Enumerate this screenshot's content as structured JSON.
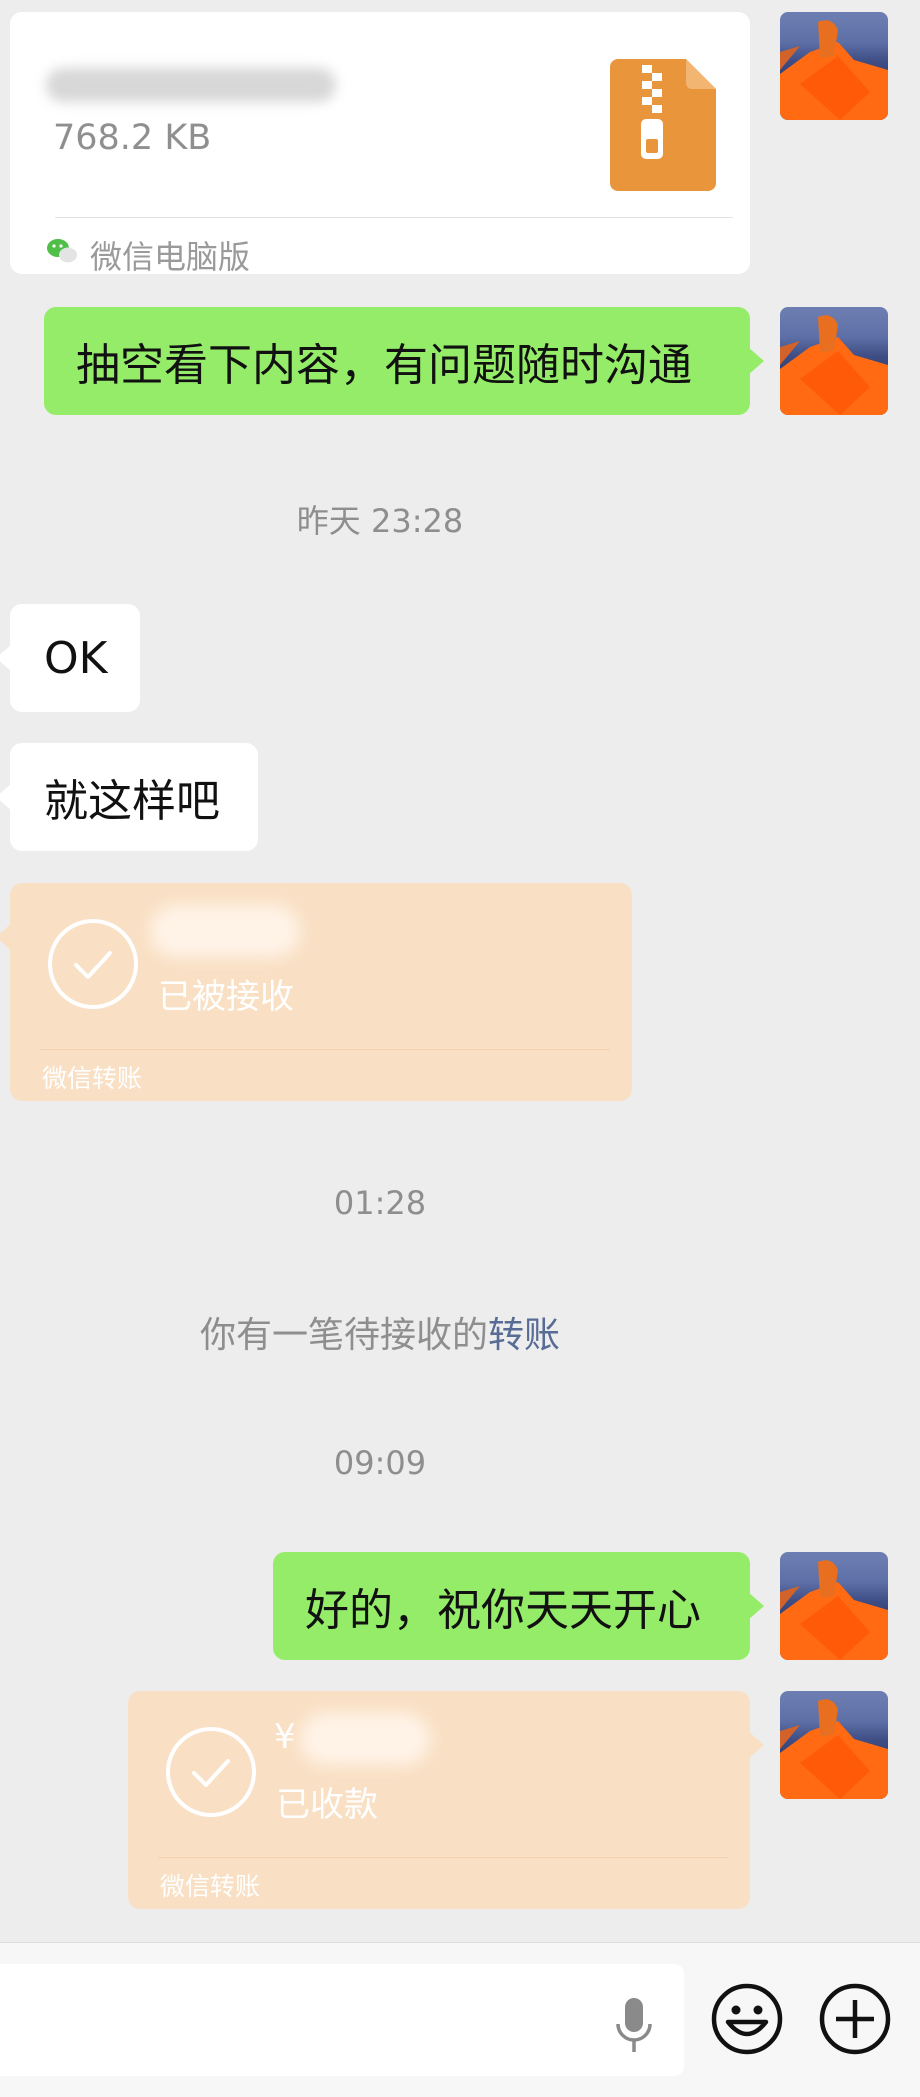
{
  "file_message": {
    "size": "768.2 KB",
    "source": "微信电脑版"
  },
  "messages": {
    "m1": "抽空看下内容，有问题随时沟通",
    "ts1": "昨天 23:28",
    "m2": "OK",
    "m3": "就这样吧",
    "ts2": "01:28",
    "ts3": "09:09",
    "m4": "好的，祝你天天开心"
  },
  "transfer_received": {
    "status": "已被接收",
    "label": "微信转账"
  },
  "system_notice": {
    "text": "你有一笔待接收的",
    "link": "转账"
  },
  "transfer_collected": {
    "currency": "¥",
    "status": "已收款",
    "label": "微信转账"
  },
  "colors": {
    "bubble_green": "#95ec69",
    "transfer_peach": "#f9e0c4",
    "link_blue": "#576b95",
    "background": "#ededed"
  }
}
